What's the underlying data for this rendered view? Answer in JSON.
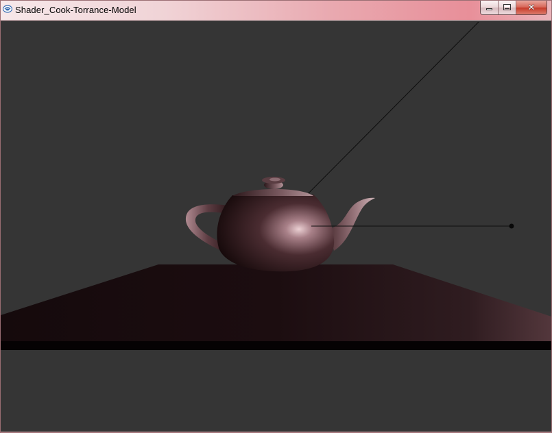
{
  "window": {
    "title": "Shader_Cook-Torrance-Model",
    "app_icon": "app-icon",
    "controls": {
      "minimize_icon": "minimize-icon",
      "maximize_icon": "maximize-icon",
      "close_icon": "close-icon",
      "close_glyph": "✕"
    }
  },
  "scene": {
    "background_color": "#353535",
    "object": "teapot",
    "object_color": "#5a3c40",
    "table_color": "#1c0f12"
  }
}
